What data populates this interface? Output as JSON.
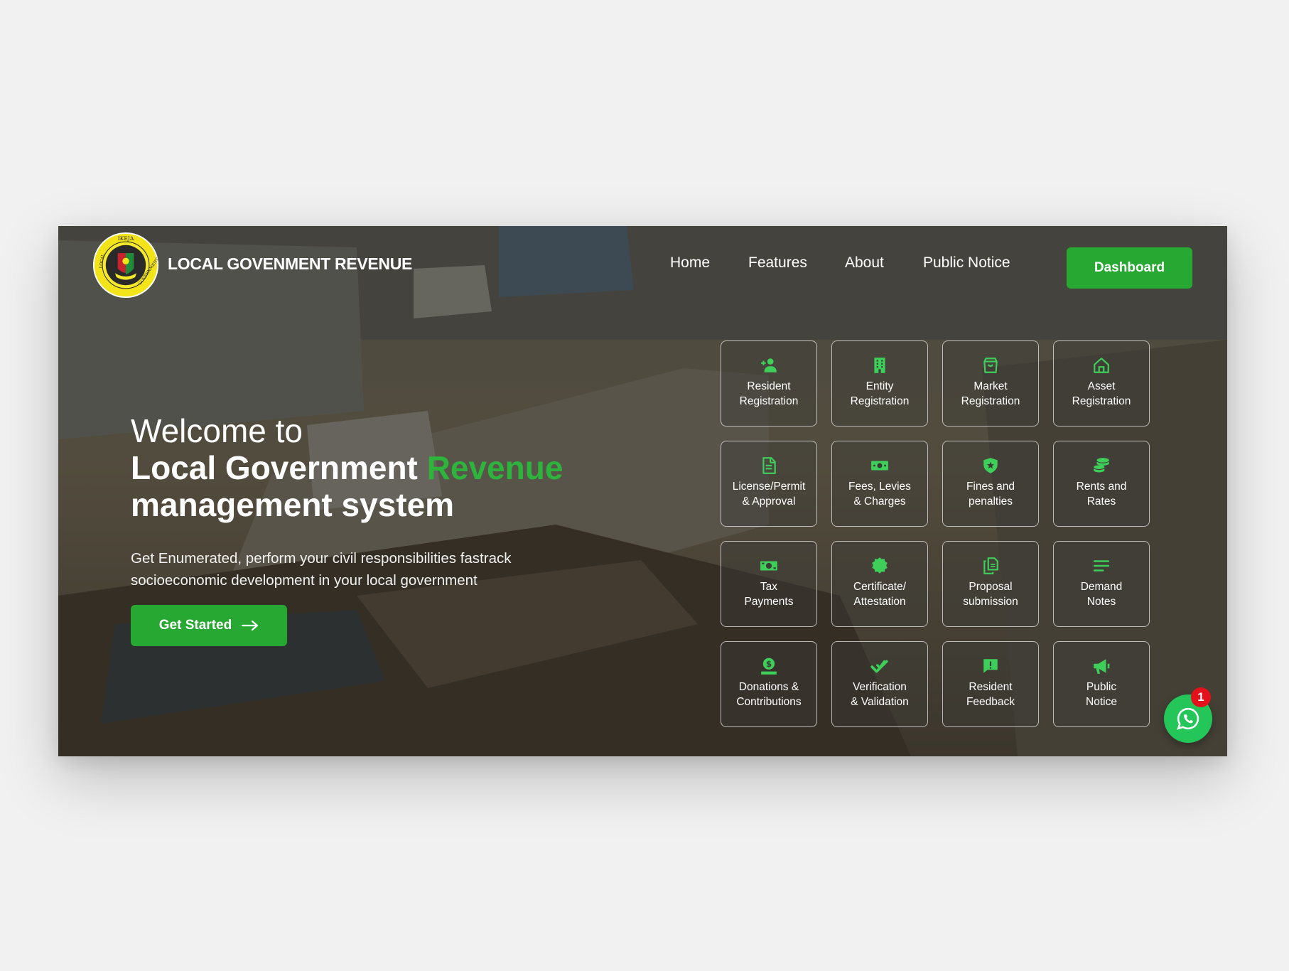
{
  "brand": {
    "name": "LOCAL GOVENMENT REVENUE",
    "logo_text_top": "IKEJA",
    "logo_text_left": "LOCAL",
    "logo_text_right": "GOVERNMENT"
  },
  "nav": {
    "items": [
      {
        "label": "Home"
      },
      {
        "label": "Features"
      },
      {
        "label": "About"
      },
      {
        "label": "Public Notice"
      }
    ],
    "dashboard_label": "Dashboard"
  },
  "hero": {
    "line1": "Welcome to",
    "line2_a": "Local Government ",
    "line2_b": "Revenue",
    "line3": "management system",
    "description": "Get Enumerated, perform your civil responsibilities fastrack socioeconomic development in your local government",
    "cta_label": "Get Started",
    "cta_icon": "arrow-right-icon"
  },
  "services": [
    {
      "label": "Resident\nRegistration",
      "icon": "user-plus-icon"
    },
    {
      "label": "Entity\nRegistration",
      "icon": "building-icon"
    },
    {
      "label": "Market\nRegistration",
      "icon": "shopping-bag-icon"
    },
    {
      "label": "Asset\nRegistration",
      "icon": "home-icon"
    },
    {
      "label": "License/Permit\n& Approval",
      "icon": "document-icon"
    },
    {
      "label": "Fees, Levies\n& Charges",
      "icon": "money-icon"
    },
    {
      "label": "Fines and\npenalties",
      "icon": "shield-star-icon"
    },
    {
      "label": "Rents and\nRates",
      "icon": "coins-icon"
    },
    {
      "label": "Tax\nPayments",
      "icon": "cash-icon"
    },
    {
      "label": "Certificate/\nAttestation",
      "icon": "badge-icon"
    },
    {
      "label": "Proposal\nsubmission",
      "icon": "copy-icon"
    },
    {
      "label": "Demand\nNotes",
      "icon": "lines-icon"
    },
    {
      "label": "Donations &\nContributions",
      "icon": "donation-icon"
    },
    {
      "label": "Verification\n& Validation",
      "icon": "double-check-icon"
    },
    {
      "label": "Resident\nFeedback",
      "icon": "feedback-icon"
    },
    {
      "label": "Public\nNotice",
      "icon": "megaphone-icon"
    }
  ],
  "whatsapp": {
    "icon": "whatsapp-icon",
    "badge": "1"
  },
  "colors": {
    "accent": "#26a833",
    "icon_green": "#3ecf5a",
    "badge_red": "#e3111b",
    "page_bg": "#f1f1f1"
  }
}
